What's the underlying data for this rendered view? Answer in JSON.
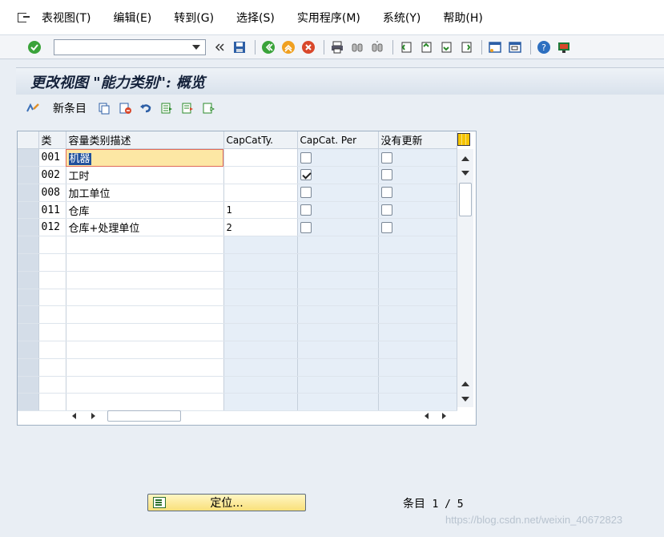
{
  "menubar": {
    "items": [
      {
        "label": "表视图(T)"
      },
      {
        "label": "编辑(E)"
      },
      {
        "label": "转到(G)"
      },
      {
        "label": "选择(S)"
      },
      {
        "label": "实用程序(M)"
      },
      {
        "label": "系统(Y)"
      },
      {
        "label": "帮助(H)"
      }
    ]
  },
  "toolbar": {
    "command_value": "",
    "icons": [
      "enter-check-icon",
      "command-dropdown",
      "collapse-icon",
      "save-icon",
      "back-icon",
      "exit-icon",
      "cancel-icon",
      "print-icon",
      "find-icon",
      "find-next-icon",
      "first-page-icon",
      "previous-page-icon",
      "next-page-icon",
      "last-page-icon",
      "new-session-icon",
      "shortcut-icon",
      "help-icon",
      "customize-layout-icon"
    ]
  },
  "title": {
    "text": "更改视图 \"能力类别\": 概览"
  },
  "app_toolbar": {
    "new_entries_label": "新条目"
  },
  "table": {
    "headers": [
      "类",
      "容量类别描述",
      "CapCatTy.",
      "CapCat. Per",
      "没有更新"
    ],
    "rows": [
      {
        "key": "001",
        "desc": "机器",
        "type": "",
        "per": false,
        "noupdate": false,
        "focused": true
      },
      {
        "key": "002",
        "desc": "工时",
        "type": "",
        "per": true,
        "noupdate": false
      },
      {
        "key": "008",
        "desc": "加工单位",
        "type": "",
        "per": false,
        "noupdate": false
      },
      {
        "key": "011",
        "desc": "仓库",
        "type": "1",
        "per": false,
        "noupdate": false
      },
      {
        "key": "012",
        "desc": "仓库+处理单位",
        "type": "2",
        "per": false,
        "noupdate": false
      }
    ],
    "empty_rows": 10
  },
  "footer": {
    "position_button": "定位...",
    "entries_label": "条目",
    "entries_count": "1 / 5"
  },
  "watermark": "https://blog.csdn.net/weixin_40672823",
  "colors": {
    "accent": "#f9e07a",
    "focus_cell": "#fde7a4",
    "selection": "#1f4f9b"
  }
}
